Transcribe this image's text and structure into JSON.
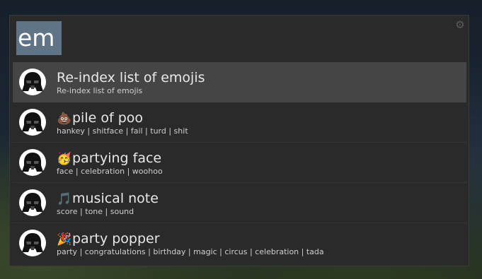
{
  "search": {
    "query": "em"
  },
  "settings": {
    "icon": "gear-icon"
  },
  "results": [
    {
      "avatar": "darth-vader-icon",
      "emoji": "",
      "title": "Re-index list of emojis",
      "subtitle": "Re-index list of emojis",
      "selected": true
    },
    {
      "avatar": "darth-vader-icon",
      "emoji": "💩",
      "title": "pile of poo",
      "subtitle": "hankey | shitface | fail | turd | shit",
      "selected": false
    },
    {
      "avatar": "darth-vader-icon",
      "emoji": "🥳",
      "title": "partying face",
      "subtitle": "face | celebration | woohoo",
      "selected": false
    },
    {
      "avatar": "darth-vader-icon",
      "emoji": "🎵",
      "title": "musical note",
      "subtitle": "score | tone | sound",
      "selected": false
    },
    {
      "avatar": "darth-vader-icon",
      "emoji": "🎉",
      "title": "party popper",
      "subtitle": "party | congratulations | birthday | magic | circus | celebration | tada",
      "selected": false
    }
  ],
  "colors": {
    "selected_row": "#454545",
    "query_highlight": "#5f7587",
    "panel": "#2a2a2a"
  }
}
